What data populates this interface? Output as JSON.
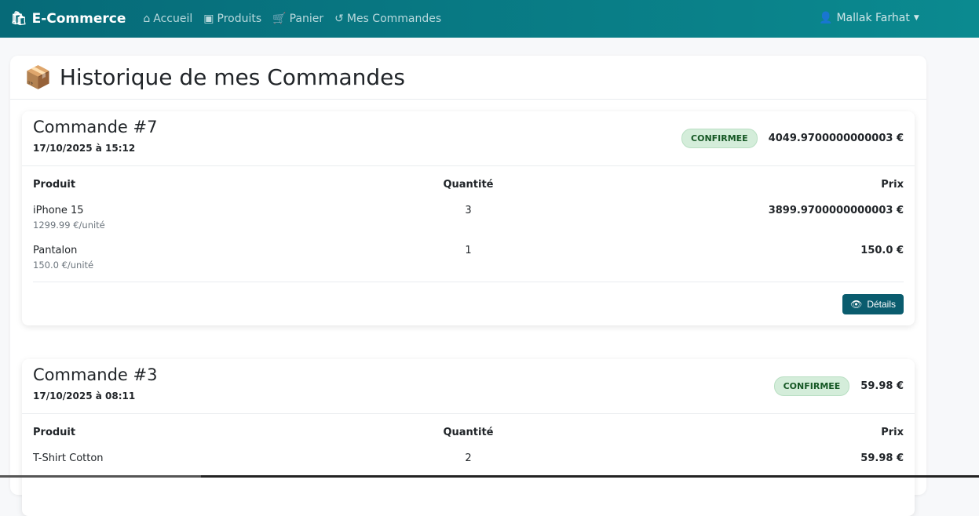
{
  "nav": {
    "brand": "E-Commerce",
    "links": [
      "Accueil",
      "Produits",
      "Panier",
      "Mes Commandes"
    ],
    "user": "Mallak Farhat"
  },
  "page": {
    "title": "Historique de mes Commandes"
  },
  "headers": {
    "product": "Produit",
    "qty": "Quantité",
    "price": "Prix"
  },
  "orders": [
    {
      "title": "Commande #7",
      "date": "17/10/2025 à 15:12",
      "status": "CONFIRMEE",
      "total": "4049.9700000000003 €",
      "details": "Détails",
      "items": [
        {
          "name": "iPhone 15",
          "unit": "1299.99 €/unité",
          "qty": "3",
          "price": "3899.9700000000003 €"
        },
        {
          "name": "Pantalon",
          "unit": "150.0 €/unité",
          "qty": "1",
          "price": "150.0 €"
        }
      ]
    },
    {
      "title": "Commande #3",
      "date": "17/10/2025 à 08:11",
      "status": "CONFIRMEE",
      "total": "59.98 €",
      "items": [
        {
          "name": "T-Shirt Cotton",
          "qty": "2",
          "price": "59.98 €"
        }
      ]
    }
  ],
  "colors": {
    "nav": "#066a78",
    "badge": "#d4edda",
    "button": "#0a5c6e"
  }
}
